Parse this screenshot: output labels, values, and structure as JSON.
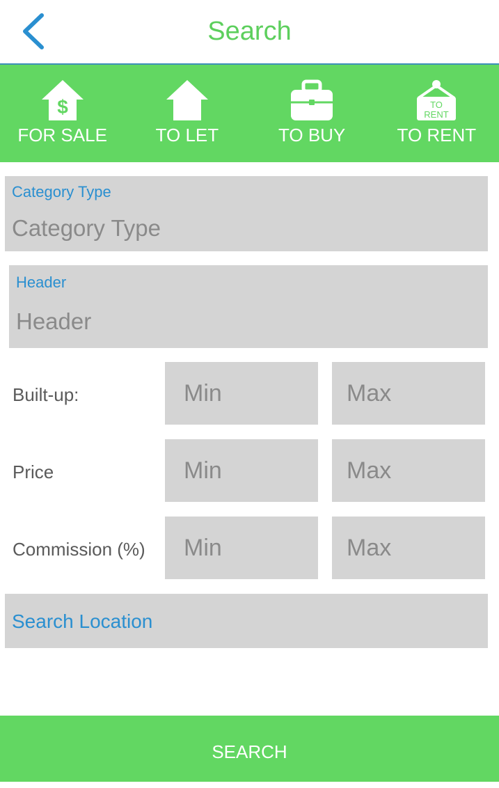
{
  "header": {
    "title": "Search"
  },
  "tabs": [
    {
      "label": "FOR SALE",
      "icon": "house-dollar-icon"
    },
    {
      "label": "TO LET",
      "icon": "house-icon"
    },
    {
      "label": "TO BUY",
      "icon": "briefcase-icon"
    },
    {
      "label": "TO RENT",
      "icon": "to-rent-sign-icon",
      "sign_text_line1": "TO",
      "sign_text_line2": "RENT"
    }
  ],
  "form": {
    "category": {
      "label": "Category Type",
      "placeholder": "Category Type"
    },
    "header": {
      "label": "Header",
      "placeholder": "Header"
    },
    "ranges": [
      {
        "label": "Built-up:",
        "min_placeholder": "Min",
        "max_placeholder": "Max"
      },
      {
        "label": "Price",
        "min_placeholder": "Min",
        "max_placeholder": "Max"
      },
      {
        "label": "Commission (%)",
        "min_placeholder": "Min",
        "max_placeholder": "Max"
      }
    ],
    "location": {
      "placeholder": "Search Location"
    }
  },
  "actions": {
    "search_label": "SEARCH"
  },
  "colors": {
    "accent_green": "#62d762",
    "title_green": "#5dcf5d",
    "link_blue": "#2a8fd0",
    "back_blue": "#2a8fd0",
    "field_bg": "#d4d4d4"
  }
}
